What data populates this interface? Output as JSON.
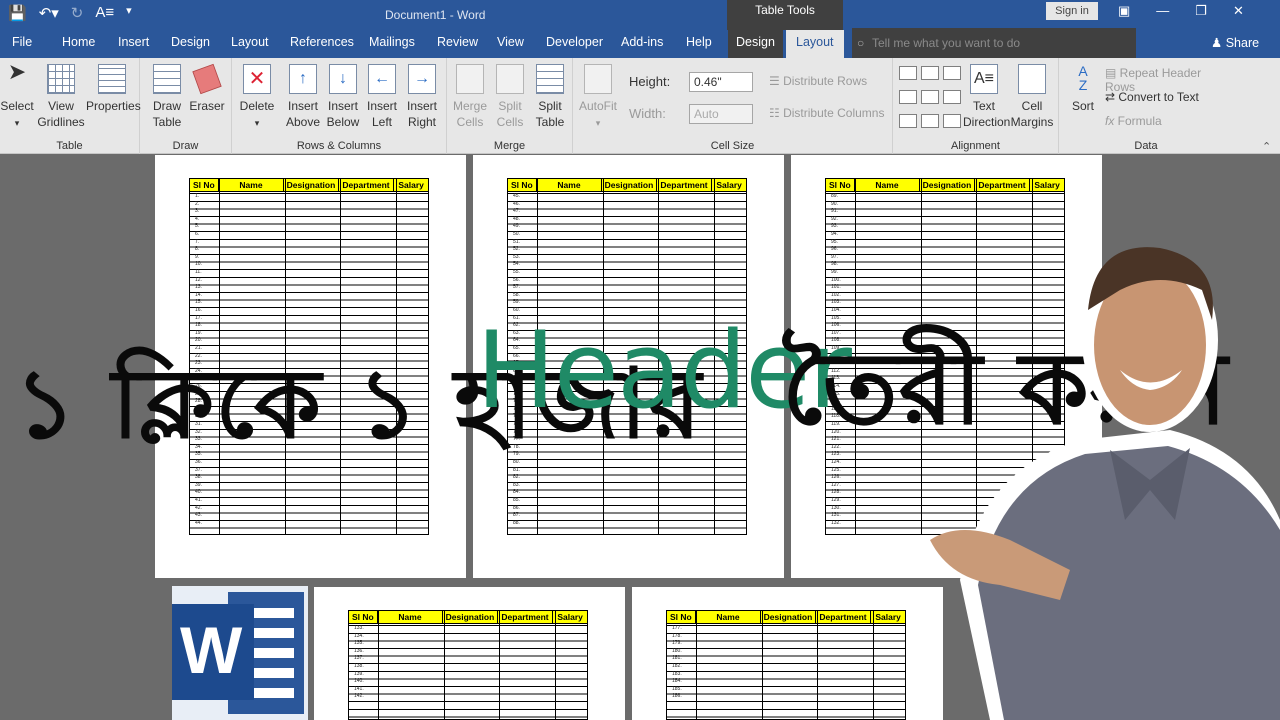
{
  "titlebar": {
    "title": "Document1 - Word",
    "contextual": "Table Tools",
    "signin": "Sign in",
    "qat": [
      "save-icon",
      "undo-icon",
      "redo-icon",
      "format-icon"
    ]
  },
  "tabs": [
    "File",
    "Home",
    "Insert",
    "Design",
    "Layout",
    "References",
    "Mailings",
    "Review",
    "View",
    "Developer",
    "Add-ins",
    "Help"
  ],
  "ctx_tabs": {
    "design": "Design",
    "layout": "Layout"
  },
  "tell_me": "Tell me what you want to do",
  "share": "Share",
  "ribbon": {
    "table": {
      "label": "Table",
      "select": "Select",
      "view_gridlines": "View Gridlines",
      "properties": "Properties"
    },
    "draw": {
      "label": "Draw",
      "draw_table": "Draw Table",
      "eraser": "Eraser"
    },
    "rows_columns": {
      "label": "Rows & Columns",
      "delete": "Delete",
      "insert_above": "Insert Above",
      "insert_below": "Insert Below",
      "insert_left": "Insert Left",
      "insert_right": "Insert Right"
    },
    "merge": {
      "label": "Merge",
      "merge_cells": "Merge Cells",
      "split_cells": "Split Cells",
      "split_table": "Split Table"
    },
    "cell_size": {
      "label": "Cell Size",
      "autofit": "AutoFit",
      "height_label": "Height:",
      "height_value": "0.46\"",
      "width_label": "Width:",
      "width_value": "Auto",
      "distribute_rows": "Distribute Rows",
      "distribute_columns": "Distribute Columns"
    },
    "alignment": {
      "label": "Alignment",
      "text_direction": "Text Direction",
      "cell_margins": "Cell Margins"
    },
    "data": {
      "label": "Data",
      "sort": "Sort",
      "repeat_header_rows": "Repeat Header Rows",
      "convert_to_text": "Convert to Text",
      "formula": "Formula"
    }
  },
  "table_headers": [
    "Sl No",
    "Name",
    "Designation",
    "Department",
    "Salary"
  ],
  "pages": [
    {
      "rows": [
        "1.",
        "2.",
        "3.",
        "4.",
        "5.",
        "6.",
        "7.",
        "8.",
        "9.",
        "10.",
        "11.",
        "12.",
        "13.",
        "14.",
        "15.",
        "16.",
        "17.",
        "18.",
        "19.",
        "20.",
        "21.",
        "22.",
        "23.",
        "24.",
        "25.",
        "26.",
        "27.",
        "28.",
        "29.",
        "30.",
        "31.",
        "32.",
        "33.",
        "34.",
        "35.",
        "36.",
        "37.",
        "38.",
        "39.",
        "40.",
        "41.",
        "42.",
        "43.",
        "44."
      ]
    },
    {
      "rows": [
        "45.",
        "46.",
        "47.",
        "48.",
        "49.",
        "50.",
        "51.",
        "52.",
        "53.",
        "54.",
        "55.",
        "56.",
        "57.",
        "58.",
        "59.",
        "60.",
        "61.",
        "62.",
        "63.",
        "64.",
        "65.",
        "66.",
        "67.",
        "68.",
        "69.",
        "70.",
        "71.",
        "72.",
        "73.",
        "74.",
        "75.",
        "76.",
        "77.",
        "78.",
        "79.",
        "80.",
        "81.",
        "82.",
        "83.",
        "84.",
        "85.",
        "86.",
        "87.",
        "88."
      ]
    },
    {
      "rows": [
        "89.",
        "90.",
        "91.",
        "92.",
        "93.",
        "94.",
        "95.",
        "96.",
        "97.",
        "98.",
        "99.",
        "100.",
        "101.",
        "102.",
        "103.",
        "104.",
        "105.",
        "106.",
        "107.",
        "108.",
        "109.",
        "110.",
        "111.",
        "112.",
        "113.",
        "114.",
        "115.",
        "116.",
        "117.",
        "118.",
        "119.",
        "120.",
        "121.",
        "122.",
        "123.",
        "124.",
        "125.",
        "126.",
        "127.",
        "128.",
        "129.",
        "130.",
        "131.",
        "132."
      ]
    },
    {
      "rows": [
        "133.",
        "134.",
        "135.",
        "136.",
        "137.",
        "138.",
        "139.",
        "140.",
        "141.",
        "142."
      ]
    },
    {
      "rows": [
        "177.",
        "178.",
        "179.",
        "180.",
        "181.",
        "182.",
        "183.",
        "184.",
        "185.",
        "186."
      ]
    }
  ],
  "overlay": {
    "bangla_left": "১ ক্লিকে ১ হাজার",
    "header_word": "Header",
    "bangla_right": "তৈরী করুন"
  },
  "logo": {
    "letter": "W",
    "colors": {
      "blue": "#2b579a",
      "header_green": "#1f8a66",
      "yellow": "#ffff00"
    }
  }
}
